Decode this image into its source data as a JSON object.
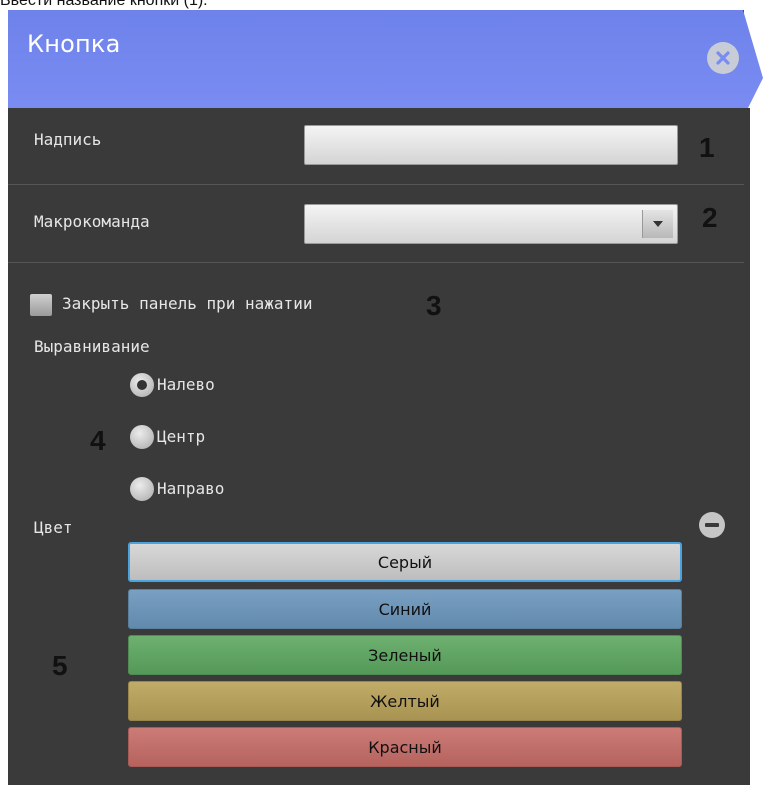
{
  "caption": "Ввести название кнопки (1).",
  "header": {
    "title": "Кнопка",
    "color": "#6d82ea"
  },
  "form": {
    "label_field": {
      "label": "Надпись",
      "value": ""
    },
    "macro_field": {
      "label": "Макрокоманда",
      "value": ""
    },
    "close_on_press": {
      "label": "Закрыть панель при нажатии",
      "checked": false
    },
    "alignment": {
      "label": "Выравнивание",
      "options": [
        {
          "label": "Налево",
          "selected": true
        },
        {
          "label": "Центр",
          "selected": false
        },
        {
          "label": "Направо",
          "selected": false
        }
      ]
    },
    "color": {
      "label": "Цвет",
      "options": [
        {
          "label": "Серый",
          "color": "#cbcbcb",
          "selected": true
        },
        {
          "label": "Синий",
          "color": "#6b93b6"
        },
        {
          "label": "Зеленый",
          "color": "#5fa262"
        },
        {
          "label": "Желтый",
          "color": "#b59f5c"
        },
        {
          "label": "Красный",
          "color": "#c26f6a"
        }
      ]
    }
  },
  "callouts": [
    "1",
    "2",
    "3",
    "4",
    "5"
  ]
}
